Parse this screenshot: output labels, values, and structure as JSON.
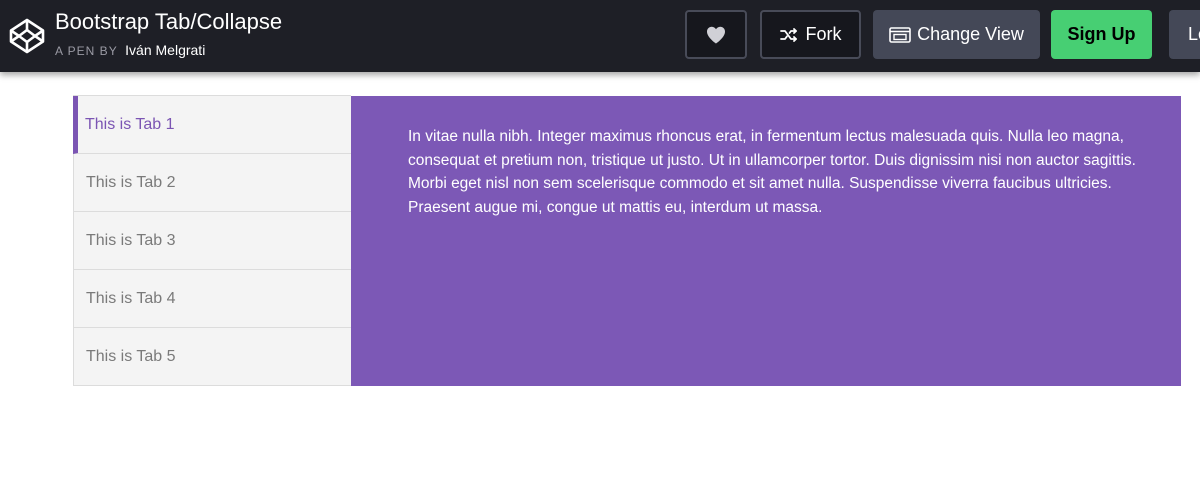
{
  "header": {
    "title": "Bootstrap Tab/Collapse",
    "byline_prefix": "A PEN BY",
    "author": "Iván Melgrati",
    "logo_icon": "codepen-logo-icon",
    "buttons": {
      "heart_icon": "heart-icon",
      "fork_label": "Fork",
      "change_view_label": "Change View",
      "signup_label": "Sign Up",
      "login_label": "Log In"
    }
  },
  "tabs": [
    {
      "label": "This is Tab 1",
      "active": true
    },
    {
      "label": "This is Tab 2",
      "active": false
    },
    {
      "label": "This is Tab 3",
      "active": false
    },
    {
      "label": "This is Tab 4",
      "active": false
    },
    {
      "label": "This is Tab 5",
      "active": false
    }
  ],
  "content": {
    "text": "In vitae nulla nibh. Integer maximus rhoncus erat, in fermentum lectus malesuada quis. Nulla leo magna, consequat et pretium non, tristique ut justo. Ut in ullamcorper tortor. Duis dignissim nisi non auctor sagittis. Morbi eget nisl non sem scelerisque commodo et sit amet nulla. Suspendisse viverra faucibus ultricies. Praesent augue mi, congue ut mattis eu, interdum ut massa."
  },
  "colors": {
    "header_bg": "#1e1f26",
    "accent_purple": "#7b55b3",
    "signup_green": "#47cf73"
  }
}
